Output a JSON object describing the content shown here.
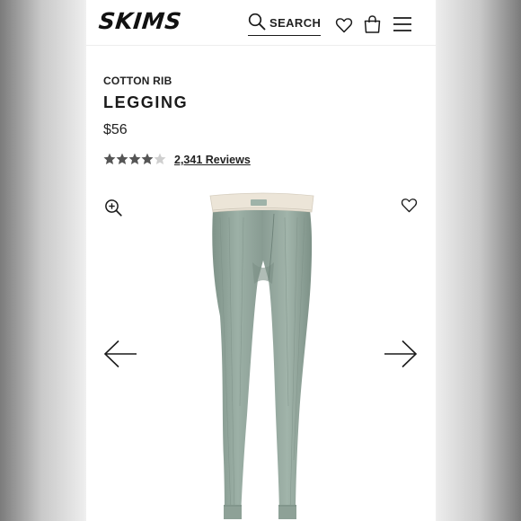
{
  "header": {
    "brand": "SKIMS",
    "search_label": "SEARCH",
    "icons": [
      "search-icon",
      "heart-icon",
      "bag-icon",
      "menu-icon"
    ]
  },
  "product": {
    "category": "COTTON RIB",
    "name": "LEGGING",
    "price": "$56",
    "rating": 4.5,
    "rating_max": 5,
    "reviews_label": "2,341 Reviews"
  },
  "gallery": {
    "icons": [
      "zoom-in-icon",
      "heart-icon",
      "arrow-left-icon",
      "arrow-right-icon"
    ]
  },
  "colors": {
    "legging": "#93a69d",
    "waistband": "#eae3d6",
    "star": "#555555",
    "text": "#1a1a1a"
  }
}
